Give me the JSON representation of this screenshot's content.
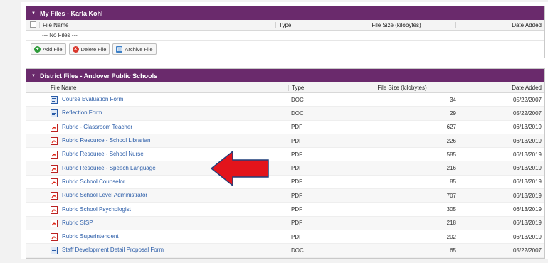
{
  "my_files": {
    "title": "My Files - Karla Kohl",
    "headers": {
      "name": "File Name",
      "type": "Type",
      "size": "File Size (kilobytes)",
      "date": "Date Added"
    },
    "empty_text": "--- No Files ---",
    "buttons": {
      "add": "Add File",
      "delete": "Delete File",
      "archive": "Archive File"
    }
  },
  "district_files": {
    "title": "District Files - Andover Public Schools",
    "headers": {
      "name": "File Name",
      "type": "Type",
      "size": "File Size (kilobytes)",
      "date": "Date Added"
    },
    "rows": [
      {
        "name": "Course Evaluation Form",
        "type": "DOC",
        "size": "34",
        "date": "05/22/2007"
      },
      {
        "name": "Reflection Form",
        "type": "DOC",
        "size": "29",
        "date": "05/22/2007"
      },
      {
        "name": "Rubric - Classroom Teacher",
        "type": "PDF",
        "size": "627",
        "date": "06/13/2019"
      },
      {
        "name": "Rubric Resource - School Librarian",
        "type": "PDF",
        "size": "226",
        "date": "06/13/2019"
      },
      {
        "name": "Rubric Resource - School Nurse",
        "type": "PDF",
        "size": "585",
        "date": "06/13/2019"
      },
      {
        "name": "Rubric Resource - Speech Language",
        "type": "PDF",
        "size": "216",
        "date": "06/13/2019"
      },
      {
        "name": "Rubric School Counselor",
        "type": "PDF",
        "size": "85",
        "date": "06/13/2019"
      },
      {
        "name": "Rubric School Level Administrator",
        "type": "PDF",
        "size": "707",
        "date": "06/13/2019"
      },
      {
        "name": "Rubric School Psychologist",
        "type": "PDF",
        "size": "305",
        "date": "06/13/2019"
      },
      {
        "name": "Rubric SISP",
        "type": "PDF",
        "size": "218",
        "date": "06/13/2019"
      },
      {
        "name": "Rubric Superintendent",
        "type": "PDF",
        "size": "202",
        "date": "06/13/2019"
      },
      {
        "name": "Staff Development Detail Proposal Form",
        "type": "DOC",
        "size": "65",
        "date": "05/22/2007"
      }
    ]
  },
  "annotation": {
    "icon": "red-arrow-left-icon",
    "color": "#e3141b"
  }
}
